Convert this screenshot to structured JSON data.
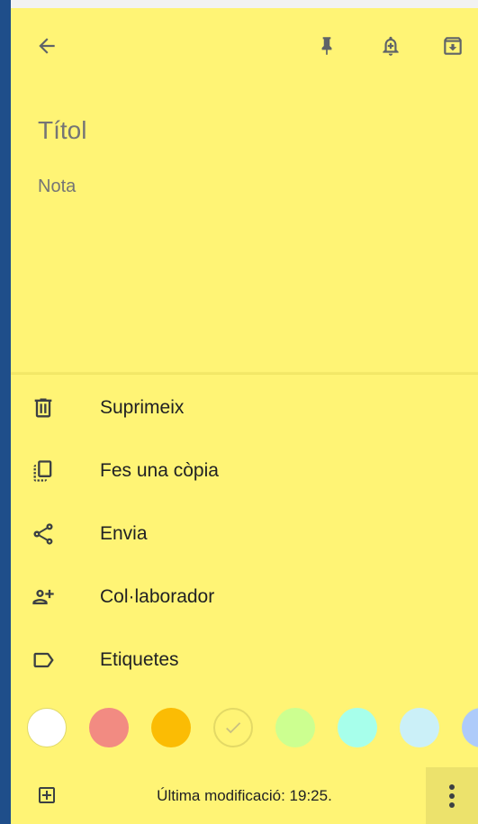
{
  "toolbar": {
    "back_icon": "arrow-back-icon",
    "pin_icon": "pin-icon",
    "reminder_icon": "add-reminder-icon",
    "archive_icon": "archive-icon"
  },
  "note": {
    "title_placeholder": "Títol",
    "body_placeholder": "Nota"
  },
  "menu": {
    "items": [
      {
        "label": "Suprimeix",
        "icon": "trash-icon"
      },
      {
        "label": "Fes una còpia",
        "icon": "copy-icon"
      },
      {
        "label": "Envia",
        "icon": "share-icon"
      },
      {
        "label": "Col·laborador",
        "icon": "add-person-icon"
      },
      {
        "label": "Etiquetes",
        "icon": "label-icon"
      }
    ]
  },
  "colors": {
    "swatches": [
      {
        "name": "white",
        "color": "#ffffff",
        "selected": false
      },
      {
        "name": "red",
        "color": "#f28b82",
        "selected": false
      },
      {
        "name": "orange",
        "color": "#fbbc04",
        "selected": false
      },
      {
        "name": "yellow",
        "color": "#fff475",
        "selected": true
      },
      {
        "name": "green",
        "color": "#ccff90",
        "selected": false
      },
      {
        "name": "teal",
        "color": "#a7ffeb",
        "selected": false
      },
      {
        "name": "blue",
        "color": "#cbf0f8",
        "selected": false
      },
      {
        "name": "dark-blue",
        "color": "#aecbfa",
        "selected": false
      }
    ]
  },
  "footer": {
    "status": "Última modificació: 19:25.",
    "add_icon": "add-box-icon",
    "more_icon": "more-vert-icon"
  },
  "theme": {
    "background": "#fff475",
    "accent_strip": "#1f4e8a"
  }
}
